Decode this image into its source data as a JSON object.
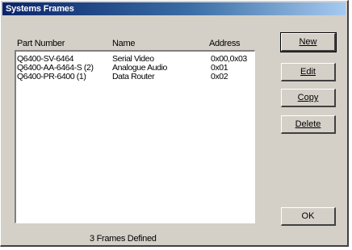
{
  "window": {
    "title": "Systems Frames"
  },
  "list": {
    "columns": [
      "Part Number",
      "Name",
      "Address"
    ],
    "rows": [
      {
        "part": "Q6400-SV-6464",
        "name": "Serial Video",
        "address": "0x00,0x03"
      },
      {
        "part": "Q6400-AA-6464-S (2)",
        "name": "Analogue Audio",
        "address": "0x01"
      },
      {
        "part": "Q6400-PR-6400 (1)",
        "name": "Data Router",
        "address": "0x02"
      }
    ]
  },
  "buttons": {
    "new": "New",
    "edit": "Edit",
    "copy": "Copy",
    "delete": "Delete",
    "ok": "OK"
  },
  "status": "3 Frames Defined"
}
